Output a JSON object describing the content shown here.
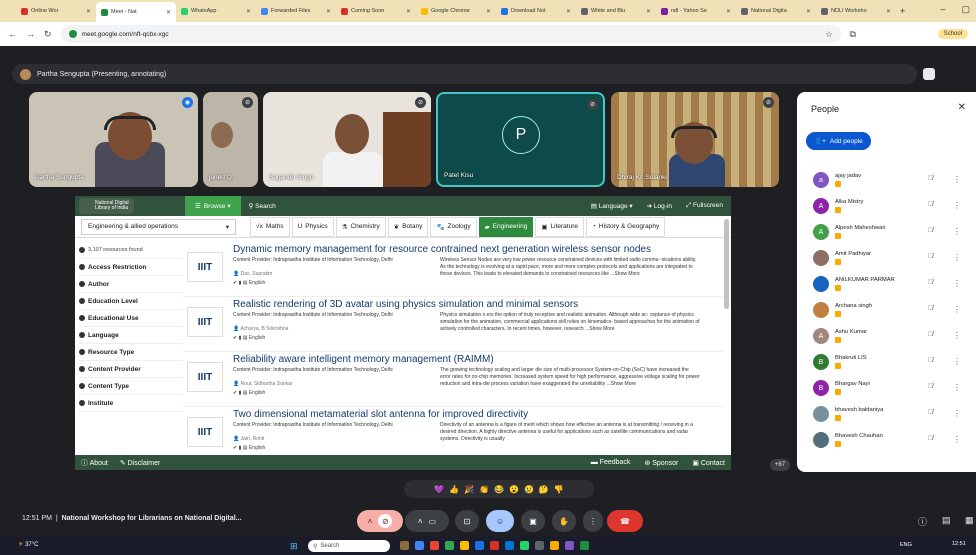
{
  "browser": {
    "tabs": [
      {
        "title": "Online Wor",
        "color": "#d93025"
      },
      {
        "title": "Meet - Nat",
        "color": "#1e8e3e",
        "active": true
      },
      {
        "title": "WhatsApp",
        "color": "#25d366"
      },
      {
        "title": "Forwarded Files",
        "color": "#4285f4"
      },
      {
        "title": "Coming Soon",
        "color": "#d93025"
      },
      {
        "title": "Google Chrome",
        "color": "#fbbc04"
      },
      {
        "title": "Download Not",
        "color": "#1a73e8"
      },
      {
        "title": "White and Blu",
        "color": "#5f6368"
      },
      {
        "title": "ndl - Yahoo Se",
        "color": "#7b1fa2"
      },
      {
        "title": "National Digita",
        "color": "#5f6368"
      },
      {
        "title": "NDLI Worksho",
        "color": "#5f6368"
      }
    ],
    "url": "meet.google.com/nft-qcbx-xgc",
    "profile": "School"
  },
  "meet": {
    "presenter_banner": "Partha Sengupta (Presenting, annotating)",
    "participants_tiles": [
      {
        "name": "Partha Sengupta"
      },
      {
        "name": "juned Q"
      },
      {
        "name": "Sugandh Singh"
      },
      {
        "name": "Patel Kisu",
        "initial": "P"
      },
      {
        "name": "Dhiraj Kr. Solanki"
      }
    ],
    "more_count": "+87",
    "reactions": [
      "💜",
      "👍",
      "🎉",
      "👏",
      "😂",
      "😮",
      "😢",
      "🤔",
      "👎"
    ],
    "time": "12:51 PM",
    "meeting_title": "National Workshop for Librarians on National Digital..."
  },
  "ndl": {
    "logo_text": "National Digital Library of India",
    "browse": "Browse",
    "search": "Search",
    "language": "Language",
    "login": "Log-in",
    "fullscreen": "Fullscreen",
    "domain": "Engineering & allied operations",
    "subjects": [
      "Maths",
      "Physics",
      "Chemistry",
      "Botany",
      "Zoology",
      "Engineering",
      "Literature",
      "History & Geography"
    ],
    "active_subject": "Engineering",
    "resource_count": "3,107 resources found",
    "filters": [
      "Access Restriction",
      "Author",
      "Education Level",
      "Educational Use",
      "Language",
      "Resource Type",
      "Content Provider",
      "Content Type",
      "Institute"
    ],
    "results": [
      {
        "title": "Dynamic memory management for resource contrained next generation wireless sensor nodes",
        "provider": "Content Provider: Indraprastha Institute of Information Technology, Delhi",
        "author": "Das, Supratim",
        "lang": "English",
        "abstract": "Wireless Sensor Nodes are very low power resource constrained devices with limited radio commu- nications ability. As the technology is evolving at a rapid pace, more and more complex protocols and applications are integrated to these devices. This leads to elevated demands to constrained resources like ...Show More"
      },
      {
        "title": "Realistic rendering of 3D avatar using physics simulation and minimal sensors",
        "provider": "Content Provider: Indraprastha Institute of Information Technology, Delhi",
        "author": "Acharya, B Srikrishna",
        "lang": "English",
        "abstract": "Physics simulation o ers the option of truly receptive and realistic animation. Although wide ac- ceptance of physics simulation for the animation, commercial applications still relies on kinematics- based approaches for the animation of actively controlled characters. In recent times, however, research ...Show More"
      },
      {
        "title": "Reliability aware intelligent memory management (RAIMM)",
        "provider": "Content Provider: Indraprastha Institute of Information Technology, Delhi",
        "author": "Rout, Sidhartha Sankar",
        "lang": "English",
        "abstract": "The growing technology scaling and larger die size of multi-processor System-on-Chip (SoC) have increased the error rates for on-chip memories. Increased system speed for high performance, aggressive voltage scaling for power reduction and intra-die process variation have exaggerated the unreliability ...Show More"
      },
      {
        "title": "Two dimensional metamaterial slot antenna for improved directivity",
        "provider": "Content Provider: Indraprastha Institute of Information Technology, Delhi",
        "author": "Jain, Rohit",
        "lang": "English",
        "abstract": "Directivity of an antenna is a figure of merit which shows how effective an antenna is at transmitting / receiving in a desired direction. A highly directive antenna is useful for applications such as satellite communications and radar systems. Directivity is usually"
      }
    ],
    "footer": {
      "about": "About",
      "disclaimer": "Disclaimer",
      "feedback": "Feedback",
      "sponsor": "Sponsor",
      "contact": "Contact"
    }
  },
  "people_panel": {
    "title": "People",
    "add_people": "Add people",
    "people": [
      {
        "name": "ajay jadav",
        "initial": "a",
        "color": "#7e57c2"
      },
      {
        "name": "Alka Mistry",
        "initial": "A",
        "color": "#8e24aa"
      },
      {
        "name": "Alpesh Maheshwari",
        "initial": "A",
        "color": "#43a047"
      },
      {
        "name": "Amit Padhiyar",
        "initial": "",
        "color": "#8d6e63"
      },
      {
        "name": "ANILKUMAR PARMAR",
        "initial": "",
        "color": "#1565c0"
      },
      {
        "name": "Archana singh",
        "initial": "",
        "color": "#bf8040"
      },
      {
        "name": "Ashu Kumar",
        "initial": "A",
        "color": "#a1887f"
      },
      {
        "name": "Bhakruti LIS",
        "initial": "B",
        "color": "#2e7d32"
      },
      {
        "name": "Bhargav Nayi",
        "initial": "B",
        "color": "#8e24aa"
      },
      {
        "name": "bhavesh baldaniya",
        "initial": "",
        "color": "#78909c"
      },
      {
        "name": "Bhavesh Chauhan",
        "initial": "",
        "color": "#546e7a"
      }
    ]
  },
  "taskbar": {
    "weather": "37°C",
    "search": "Search",
    "lang": "ENG",
    "time": "12:51"
  }
}
